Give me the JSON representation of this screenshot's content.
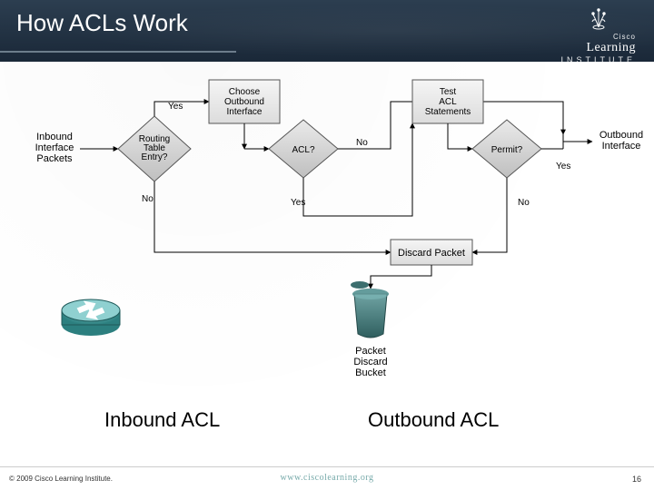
{
  "header": {
    "title": "How ACLs Work",
    "logo_top": "Cisco",
    "logo_main": "Learning",
    "logo_sub": "INSTITUTE"
  },
  "flow": {
    "inbound_packets_l1": "Inbound",
    "inbound_packets_l2": "Interface",
    "inbound_packets_l3": "Packets",
    "routing_l1": "Routing",
    "routing_l2": "Table",
    "routing_l3": "Entry?",
    "choose_l1": "Choose",
    "choose_l2": "Outbound",
    "choose_l3": "Interface",
    "acl_q": "ACL?",
    "test_l1": "Test",
    "test_l2": "ACL",
    "test_l3": "Statements",
    "permit_q": "Permit?",
    "outbound_l1": "Outbound",
    "outbound_l2": "Interface",
    "yes": "Yes",
    "no": "No",
    "discard": "Discard Packet",
    "bucket_l1": "Packet",
    "bucket_l2": "Discard",
    "bucket_l3": "Bucket"
  },
  "sections": {
    "left": "Inbound ACL",
    "right": "Outbound ACL"
  },
  "footer": {
    "copyright": "© 2009 Cisco Learning Institute.",
    "url": "www.ciscolearning.org",
    "page": "16"
  },
  "chart_data": {
    "type": "flowchart",
    "title": "How ACLs Work",
    "nodes": [
      {
        "id": "in_pkts",
        "type": "io",
        "label": "Inbound Interface Packets"
      },
      {
        "id": "rt_entry",
        "type": "decision",
        "label": "Routing Table Entry?"
      },
      {
        "id": "choose_if",
        "type": "process",
        "label": "Choose Outbound Interface"
      },
      {
        "id": "acl_q",
        "type": "decision",
        "label": "ACL?"
      },
      {
        "id": "test_acl",
        "type": "process",
        "label": "Test ACL Statements"
      },
      {
        "id": "permit_q",
        "type": "decision",
        "label": "Permit?"
      },
      {
        "id": "out_if",
        "type": "io",
        "label": "Outbound Interface"
      },
      {
        "id": "discard",
        "type": "terminator",
        "label": "Discard Packet"
      },
      {
        "id": "bucket",
        "type": "object",
        "label": "Packet Discard Bucket"
      },
      {
        "id": "router",
        "type": "object",
        "label": "Router"
      }
    ],
    "edges": [
      {
        "from": "in_pkts",
        "to": "rt_entry",
        "label": ""
      },
      {
        "from": "rt_entry",
        "to": "choose_if",
        "label": "Yes"
      },
      {
        "from": "rt_entry",
        "to": "discard",
        "label": "No"
      },
      {
        "from": "choose_if",
        "to": "acl_q",
        "label": ""
      },
      {
        "from": "acl_q",
        "to": "out_if",
        "label": "No"
      },
      {
        "from": "acl_q",
        "to": "test_acl",
        "label": "Yes"
      },
      {
        "from": "test_acl",
        "to": "permit_q",
        "label": ""
      },
      {
        "from": "permit_q",
        "to": "out_if",
        "label": "Yes"
      },
      {
        "from": "permit_q",
        "to": "discard",
        "label": "No"
      },
      {
        "from": "discard",
        "to": "bucket",
        "label": ""
      }
    ],
    "groupings": [
      {
        "label": "Inbound ACL",
        "nodes": [
          "in_pkts",
          "rt_entry",
          "choose_if"
        ]
      },
      {
        "label": "Outbound ACL",
        "nodes": [
          "acl_q",
          "test_acl",
          "permit_q",
          "out_if"
        ]
      }
    ]
  }
}
